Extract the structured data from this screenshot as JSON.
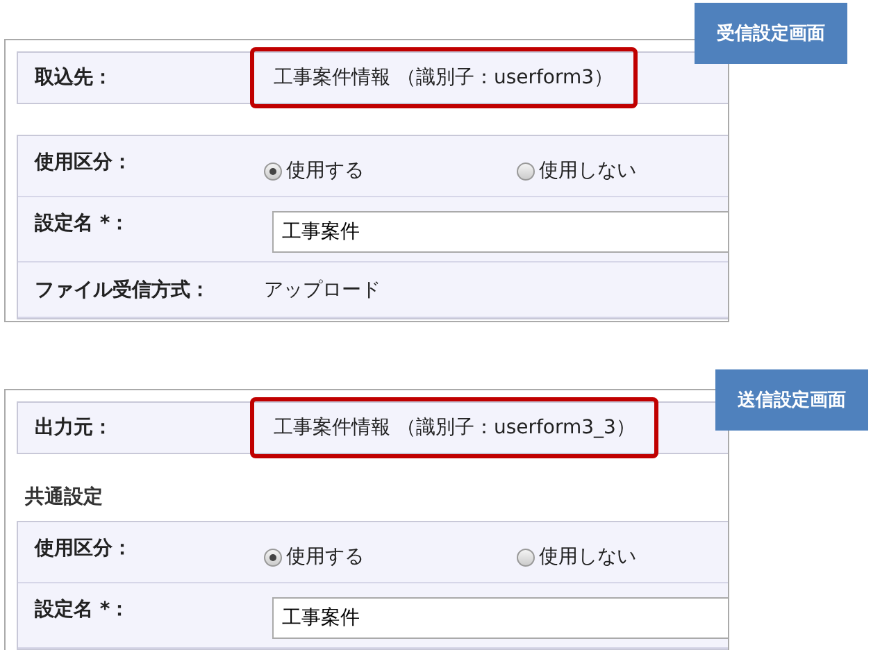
{
  "panels": [
    {
      "callout": "受信設定画面",
      "source": {
        "label": "取込先：",
        "value": "工事案件情報 （識別子：userform3）",
        "highlighted": true
      },
      "rows": [
        {
          "kind": "radio",
          "label": "使用区分：",
          "options": [
            {
              "label": "使用する",
              "selected": true
            },
            {
              "label": "使用しない",
              "selected": false
            }
          ]
        },
        {
          "kind": "input",
          "label": "設定名 *：",
          "value": "工事案件"
        },
        {
          "kind": "text",
          "label": "ファイル受信方式：",
          "value": "アップロード"
        }
      ]
    },
    {
      "callout": "送信設定画面",
      "source": {
        "label": "出力元：",
        "value": "工事案件情報 （識別子：userform3_3）",
        "highlighted": true
      },
      "section_title": "共通設定",
      "rows": [
        {
          "kind": "radio",
          "label": "使用区分：",
          "options": [
            {
              "label": "使用する",
              "selected": true
            },
            {
              "label": "使用しない",
              "selected": false
            }
          ]
        },
        {
          "kind": "input",
          "label": "設定名 *：",
          "value": "工事案件"
        }
      ]
    }
  ]
}
